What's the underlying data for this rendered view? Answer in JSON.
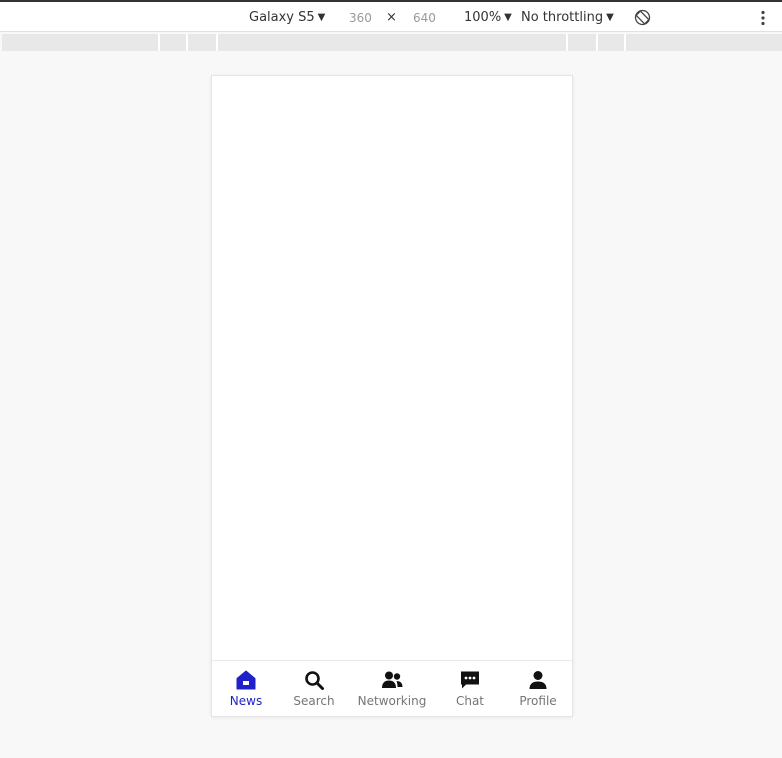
{
  "toolbar": {
    "device": "Galaxy S5",
    "width": "360",
    "times": "×",
    "height": "640",
    "zoom": "100%",
    "throttling": "No throttling",
    "caret": "▼"
  },
  "bottom_nav": {
    "items": [
      {
        "label": "News",
        "icon": "home-icon",
        "active": true
      },
      {
        "label": "Search",
        "icon": "search-icon"
      },
      {
        "label": "Networking",
        "icon": "people-icon"
      },
      {
        "label": "Chat",
        "icon": "chat-icon"
      },
      {
        "label": "Profile",
        "icon": "person-icon"
      }
    ]
  },
  "colors": {
    "active": "#1e22c8",
    "inactive_label": "#757575",
    "icon": "#111111"
  }
}
